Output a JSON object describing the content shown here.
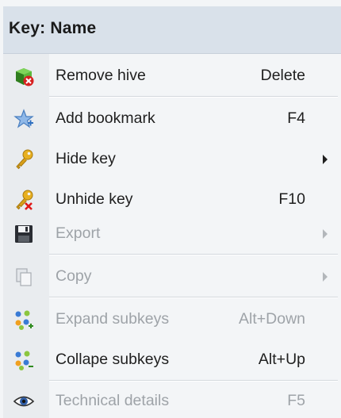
{
  "header": {
    "title": "Key: Name"
  },
  "items": [
    {
      "label": "Remove hive",
      "shortcut": "Delete",
      "icon": "remove-hive-icon",
      "enabled": true,
      "submenu": false
    },
    {
      "label": "Add bookmark",
      "shortcut": "F4",
      "icon": "star-bookmark-icon",
      "enabled": true,
      "submenu": false
    },
    {
      "label": "Hide key",
      "shortcut": "",
      "icon": "key-icon",
      "enabled": true,
      "submenu": true
    },
    {
      "label": "Unhide key",
      "shortcut": "F10",
      "icon": "key-x-icon",
      "enabled": true,
      "submenu": false
    },
    {
      "label": "Export",
      "shortcut": "",
      "icon": "save-disk-icon",
      "enabled": false,
      "submenu": true
    },
    {
      "label": "Copy",
      "shortcut": "",
      "icon": "copy-icon",
      "enabled": false,
      "submenu": true
    },
    {
      "label": "Expand subkeys",
      "shortcut": "Alt+Down",
      "icon": "expand-subkeys-icon",
      "enabled": false,
      "submenu": false
    },
    {
      "label": "Collape subkeys",
      "shortcut": "Alt+Up",
      "icon": "collapse-subkeys-icon",
      "enabled": true,
      "submenu": false
    },
    {
      "label": "Technical details",
      "shortcut": "F5",
      "icon": "eye-icon",
      "enabled": false,
      "submenu": false
    }
  ],
  "colors": {
    "enabled_text": "#1f1f1f",
    "disabled_text": "#9ea3a8",
    "header_bg": "#d9e1ea",
    "menu_bg": "#f3f5f7",
    "gutter_bg": "#e9ecef"
  }
}
